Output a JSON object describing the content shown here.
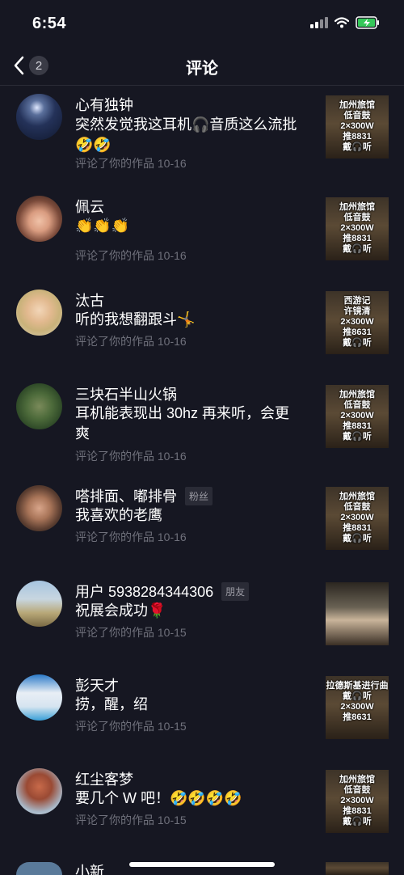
{
  "status": {
    "time": "6:54"
  },
  "header": {
    "back_count": "2",
    "title": "评论"
  },
  "comments": [
    {
      "name": "心有独钟",
      "tag": "",
      "text": "突然发觉我这耳机🎧音质这么流批🤣🤣",
      "meta": "评论了你的作品  10-16",
      "thumb": [
        "加州旅馆",
        "低音鼓",
        "2×300W",
        "推8831",
        "戴🎧听"
      ]
    },
    {
      "name": "佩云",
      "tag": "",
      "text": "👏👏👏",
      "meta": "评论了你的作品  10-16",
      "thumb": [
        "加州旅馆",
        "低音鼓",
        "2×300W",
        "推8831",
        "戴🎧听"
      ]
    },
    {
      "name": "汰古",
      "tag": "",
      "text": "听的我想翻跟斗🤸",
      "meta": "评论了你的作品  10-16",
      "thumb": [
        "西游记",
        "许镜清",
        "2×300W",
        "推8631",
        "戴🎧听"
      ]
    },
    {
      "name": "三块石半山火锅",
      "tag": "",
      "text": "耳机能表现出 30hz 再来听，会更爽",
      "meta": "评论了你的作品  10-16",
      "thumb": [
        "加州旅馆",
        "低音鼓",
        "2×300W",
        "推8831",
        "戴🎧听"
      ]
    },
    {
      "name": "嗒排面、嘟排骨",
      "tag": "粉丝",
      "text": "我喜欢的老鹰",
      "meta": "评论了你的作品  10-16",
      "thumb": [
        "加州旅馆",
        "低音鼓",
        "2×300W",
        "推8831",
        "戴🎧听"
      ]
    },
    {
      "name": "用户 5938284344306",
      "tag": "朋友",
      "text": "祝展会成功🌹",
      "meta": "评论了你的作品  10-15",
      "thumb": []
    },
    {
      "name": "彭天才",
      "tag": "",
      "text": "捞，醒，绍",
      "meta": "评论了你的作品  10-15",
      "thumb": [
        "拉德斯基进行曲",
        "戴🎧听",
        "2×300W",
        "推8631"
      ]
    },
    {
      "name": "红尘客梦",
      "tag": "",
      "text": "要几个 W 吧！🤣🤣🤣🤣",
      "meta": "评论了你的作品  10-15",
      "thumb": [
        "加州旅馆",
        "低音鼓",
        "2×300W",
        "推8831",
        "戴🎧听"
      ]
    },
    {
      "name": "小新",
      "tag": "",
      "text": "",
      "meta": "",
      "thumb": []
    }
  ],
  "colors": {
    "background": "#161722",
    "meta": "#6f707b",
    "tag_bg": "#2a2b36"
  },
  "icons": [
    "signal-icon",
    "wifi-icon",
    "battery-charging-icon",
    "back-chevron-icon"
  ]
}
